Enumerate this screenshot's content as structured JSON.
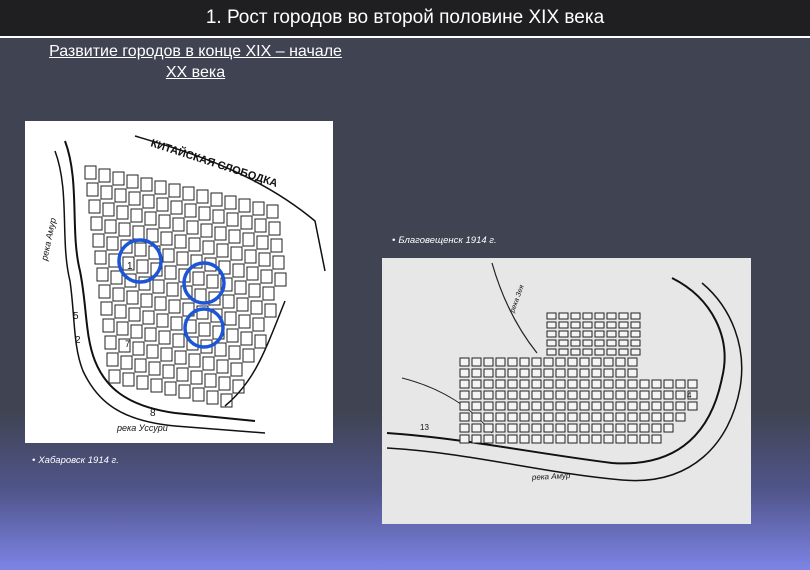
{
  "title": "1. Рост городов во второй половине XIX века",
  "subtitle_line1": "Развитие городов в конце XIX – начале",
  "subtitle_line2": "XX века",
  "map_khabarovsk": {
    "caption": "Хабаровск 1914 г.",
    "labels": {
      "slobodka": "КИТАЙСКАЯ СЛОБОДКА",
      "amur": "река Амур",
      "ussuri": "река Уссури",
      "n1": "1",
      "n2": "2",
      "n5": "5",
      "n8": "8",
      "n7": "7"
    },
    "highlight_color": "#1c56d6"
  },
  "map_blagoveshchensk": {
    "caption": "Благовещенск 1914 г.",
    "labels": {
      "amur": "река Амур",
      "river_left": "река Зея",
      "n13": "13",
      "n4": "4"
    }
  }
}
